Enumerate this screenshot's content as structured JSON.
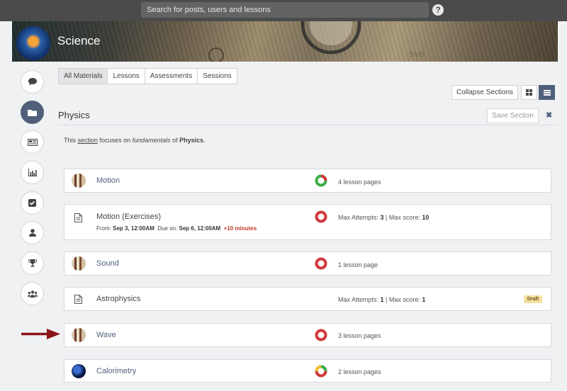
{
  "topbar": {
    "search_placeholder": "Search for posts, users and lessons",
    "help_label": "?"
  },
  "course": {
    "title": "Science"
  },
  "nav": [
    "comment-icon",
    "folder-icon",
    "newspaper-icon",
    "bar-chart-icon",
    "checkbox-icon",
    "user-icon",
    "trophy-icon",
    "users-icon"
  ],
  "tabs": [
    {
      "label": "All Materials",
      "active": true
    },
    {
      "label": "Lessons"
    },
    {
      "label": "Assessments"
    },
    {
      "label": "Sessions"
    }
  ],
  "toolbar": {
    "collapse_label": "Collapse Sections",
    "grid_view": "grid-icon",
    "list_view": "list-icon"
  },
  "section": {
    "title": "Physics",
    "save_label": "Save Section",
    "close_label": "✖",
    "description": {
      "prefix": "This ",
      "link": "section",
      "mid": " focuses on ",
      "emph": "fundamentals",
      "mid2": " of ",
      "strong": "Physics",
      "suffix": "."
    }
  },
  "items": [
    {
      "title": "Motion",
      "type": "lesson",
      "ring": "green-red",
      "info": "4 lesson pages"
    },
    {
      "title": "Motion (Exercises)",
      "type": "assessment",
      "ring": "red",
      "schedule": {
        "from_label": "From: ",
        "from": "Sep 3, 12:00AM",
        "due_label": "Due on: ",
        "due": "Sep 6, 12:00AM",
        "late": "+10 minutes"
      },
      "attempts_label": "Max Attempts: ",
      "attempts": "3",
      "sep": " | ",
      "score_label": "Max score: ",
      "score": "10"
    },
    {
      "title": "Sound",
      "type": "lesson",
      "ring": "red",
      "info": "1 lesson page"
    },
    {
      "title": "Astrophysics",
      "type": "assessment",
      "attempts_label": "Max Attempts: ",
      "attempts": "1",
      "sep": " | ",
      "score_label": "Max score: ",
      "score": "1",
      "badge": "Draft"
    },
    {
      "title": "Wave",
      "type": "lesson",
      "ring": "red",
      "info": "3 lesson pages"
    },
    {
      "title": "Calorimetry",
      "type": "lesson",
      "ring": "green-yellow-red",
      "info": "2 lesson pages"
    }
  ],
  "colors": {
    "accent": "#50607a",
    "ring_red": "#d0393b",
    "ring_green": "#3eae48",
    "ring_yellow": "#e9c42b",
    "arrow": "#8b1418"
  }
}
